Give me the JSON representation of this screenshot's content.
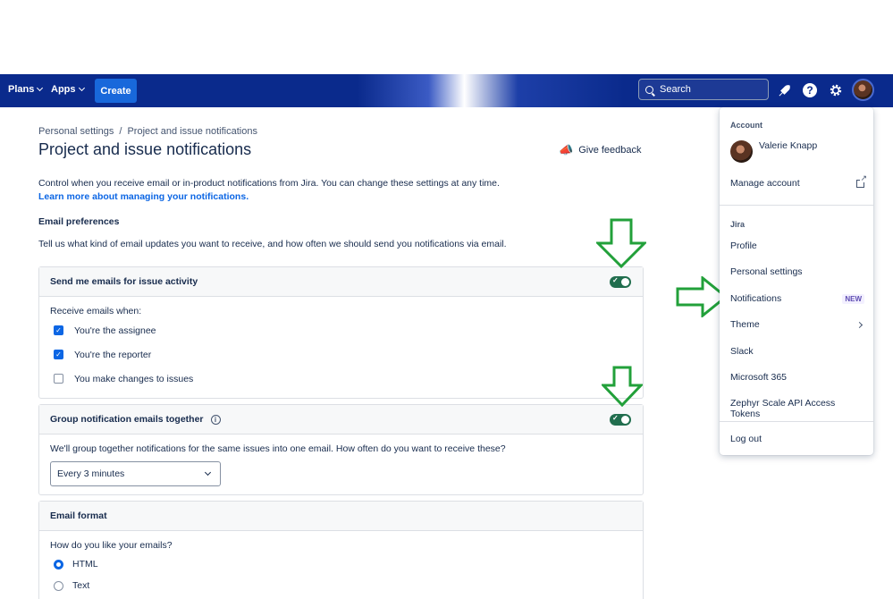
{
  "topbar": {
    "plans_label": "Plans",
    "apps_label": "Apps",
    "create_label": "Create",
    "search_placeholder": "Search"
  },
  "breadcrumb": {
    "root": "Personal settings",
    "separator": "/",
    "current": "Project and issue notifications"
  },
  "page": {
    "title": "Project and issue notifications",
    "feedback_label": "Give feedback",
    "intro_text": "Control when you receive email or in-product notifications from Jira. You can change these settings at any time.",
    "intro_link": "Learn more about managing your notifications.",
    "email_prefs_heading": "Email preferences",
    "email_prefs_desc": "Tell us what kind of email updates you want to receive, and how often we should send you notifications via email."
  },
  "issue_activity": {
    "title": "Send me emails for issue activity",
    "enabled": true,
    "receive_label": "Receive emails when:",
    "options": [
      {
        "label": "You're the assignee",
        "checked": true
      },
      {
        "label": "You're the reporter",
        "checked": true
      },
      {
        "label": "You make changes to issues",
        "checked": false
      }
    ]
  },
  "grouping": {
    "title": "Group notification emails together",
    "enabled": true,
    "desc": "We'll group together notifications for the same issues into one email. How often do you want to receive these?",
    "selected": "Every 3 minutes"
  },
  "email_format": {
    "title": "Email format",
    "question": "How do you like your emails?",
    "options": [
      {
        "label": "HTML",
        "selected": true
      },
      {
        "label": "Text",
        "selected": false
      }
    ]
  },
  "menu": {
    "account_title": "Account",
    "user_name": "Valerie Knapp",
    "manage_account": "Manage account",
    "jira_title": "Jira",
    "items": [
      "Profile",
      "Personal settings",
      "Notifications",
      "Theme",
      "Slack",
      "Microsoft 365",
      "Zephyr Scale API Access Tokens"
    ],
    "new_badge": "NEW",
    "logout": "Log out"
  },
  "colors": {
    "topbar": "#0a2a8c",
    "create_button": "#1868db",
    "toggle_on": "#216e4e",
    "link": "#0c66e4",
    "annotation_arrow": "#22a03a"
  }
}
